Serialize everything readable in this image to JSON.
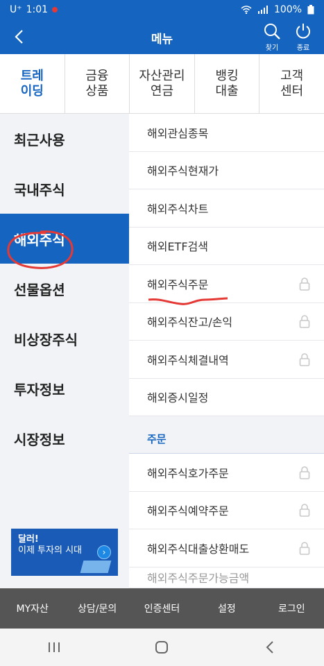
{
  "status": {
    "carrier": "U⁺",
    "time": "1:01",
    "battery": "100%"
  },
  "header": {
    "title": "메뉴",
    "search_label": "찾기",
    "close_label": "종료"
  },
  "top_categories": [
    {
      "label": "트레\n이딩",
      "active": true
    },
    {
      "label": "금융\n상품"
    },
    {
      "label": "자산관리\n연금"
    },
    {
      "label": "뱅킹\n대출"
    },
    {
      "label": "고객\n센터"
    }
  ],
  "sidebar": {
    "items": [
      {
        "label": "최근사용"
      },
      {
        "label": "국내주식"
      },
      {
        "label": "해외주식",
        "active": true
      },
      {
        "label": "선물옵션"
      },
      {
        "label": "비상장주식"
      },
      {
        "label": "투자정보"
      },
      {
        "label": "시장정보"
      }
    ],
    "banner": {
      "line1": "달러!",
      "line2": "이제 투자의 시대"
    }
  },
  "menu_list": {
    "items": [
      {
        "label": "해외관심종목",
        "locked": false
      },
      {
        "label": "해외주식현재가",
        "locked": false
      },
      {
        "label": "해외주식차트",
        "locked": false
      },
      {
        "label": "해외ETF검색",
        "locked": false
      },
      {
        "label": "해외주식주문",
        "locked": true
      },
      {
        "label": "해외주식잔고/손익",
        "locked": true
      },
      {
        "label": "해외주식체결내역",
        "locked": true
      },
      {
        "label": "해외증시일정",
        "locked": false
      }
    ],
    "section_title": "주문",
    "section_items": [
      {
        "label": "해외주식호가주문",
        "locked": true
      },
      {
        "label": "해외주식예약주문",
        "locked": true
      },
      {
        "label": "해외주식대출상환매도",
        "locked": true
      }
    ],
    "partial_item": "해외주식주문가능금액"
  },
  "bottom_bar": [
    {
      "label": "MY자산"
    },
    {
      "label": "상담/문의"
    },
    {
      "label": "인증센터"
    },
    {
      "label": "설정"
    },
    {
      "label": "로그인"
    }
  ],
  "colors": {
    "primary": "#1565c0",
    "annotation": "#e53935"
  }
}
